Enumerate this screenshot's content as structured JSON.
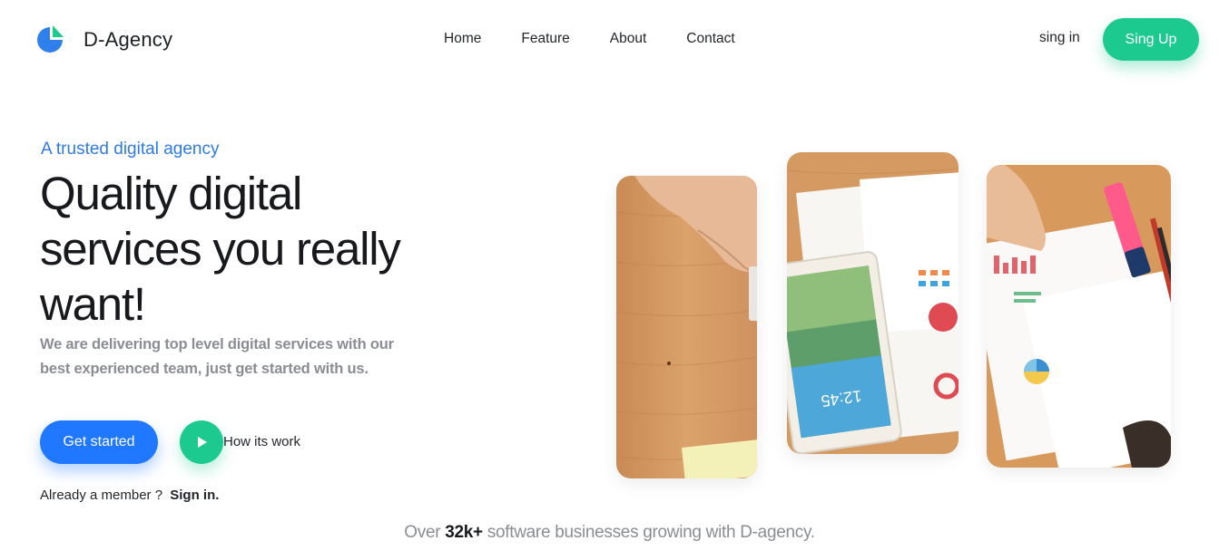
{
  "header": {
    "brand": "D-Agency",
    "nav": [
      {
        "label": "Home"
      },
      {
        "label": "Feature"
      },
      {
        "label": "About"
      },
      {
        "label": "Contact"
      }
    ],
    "signin_label": "sing in",
    "signup_label": "Sing Up"
  },
  "hero": {
    "eyebrow": "A trusted digital agency",
    "headline": "Quality digital services you really want!",
    "subtext": "We are delivering top level digital services with our best experienced team, just get started with us.",
    "cta_label": "Get started",
    "play_label": "How its work",
    "member_text": "Already a member ?",
    "member_link": "Sign in."
  },
  "footer_line": {
    "prefix": "Over ",
    "highlight": "32k+",
    "suffix": " software businesses growing with D-agency."
  },
  "colors": {
    "primary_blue": "#1f78ff",
    "accent_green": "#1cc98f",
    "eyebrow_blue": "#2e7be6",
    "text_dark": "#17191c",
    "text_muted": "#8a8d92"
  },
  "icons": [
    "logo-pie-icon",
    "play-icon"
  ]
}
